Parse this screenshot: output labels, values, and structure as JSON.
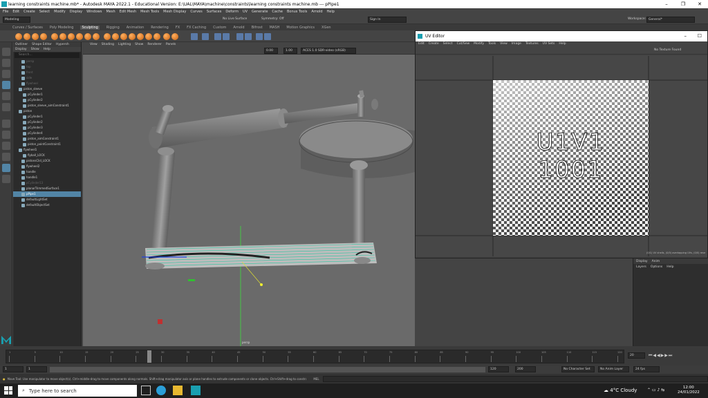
{
  "window": {
    "title": "learning constraints machine.mb* - Autodesk MAYA 2022.1 - Educational Version: E:\\UAL\\MAYA\\machine\\constraints\\learning constraints machine.mb  ---  pPipe1",
    "minimize": "–",
    "maximize": "❐",
    "close": "✕"
  },
  "menus": [
    "File",
    "Edit",
    "Create",
    "Select",
    "Modify",
    "Display",
    "Windows",
    "Mesh",
    "Edit Mesh",
    "Mesh Tools",
    "Mesh Display",
    "Curves",
    "Surfaces",
    "Deform",
    "UV",
    "Generate",
    "Cache",
    "Bonus Tools",
    "Arnold",
    "Help"
  ],
  "status": {
    "mode": "Modeling",
    "no_live_surface": "No Live Surface",
    "symmetry": "Symmetry: Off",
    "sign_in": "Sign In",
    "workspace_label": "Workspace:",
    "workspace_value": "General*"
  },
  "shelf_tabs": [
    "Curves / Surfaces",
    "Poly Modeling",
    "Sculpting",
    "Rigging",
    "Animation",
    "Rendering",
    "FX",
    "FX Caching",
    "Custom",
    "Arnold",
    "Bifrost",
    "MASH",
    "Motion Graphics",
    "XGen"
  ],
  "outliner": {
    "tabs": [
      "Outliner",
      "Shape Editor",
      "Hypersh"
    ],
    "menu": [
      "Display",
      "Show",
      "Help"
    ],
    "search_placeholder": "Search...",
    "items": [
      {
        "label": "persp",
        "dim": true
      },
      {
        "label": "top",
        "dim": true
      },
      {
        "label": "front",
        "dim": true
      },
      {
        "label": "side",
        "dim": true
      },
      {
        "label": "flywheel",
        "dim": true
      },
      {
        "label": "piston_sleeve"
      },
      {
        "label": "pCylinder1"
      },
      {
        "label": "pCylinder2"
      },
      {
        "label": "piston_sleeve_aimConstraint1"
      },
      {
        "label": "piston"
      },
      {
        "label": "pCylinder1"
      },
      {
        "label": "pCylinder2"
      },
      {
        "label": "pCylinder3"
      },
      {
        "label": "pCylinder4"
      },
      {
        "label": "piston_aimConstraint1"
      },
      {
        "label": "piston_pointConstraint1"
      },
      {
        "label": "flywheel1"
      },
      {
        "label": "flyball_LOCK"
      },
      {
        "label": "pistonsClid_LOCK"
      },
      {
        "label": "flywheel2"
      },
      {
        "label": "handle"
      },
      {
        "label": "handle1"
      },
      {
        "label": "pCylinder13",
        "dim": true
      },
      {
        "label": "planarTrimmedSurface1"
      },
      {
        "label": "pPipe1",
        "selected": true
      },
      {
        "label": "defaultLightSet"
      },
      {
        "label": "defaultObjectSet"
      }
    ]
  },
  "viewport": {
    "menu": [
      "View",
      "Shading",
      "Lighting",
      "Show",
      "Renderer",
      "Panels"
    ],
    "exposure": "0.00",
    "gamma": "1.00",
    "colorspace": "ACES 1.0 SDR-video (sRGB)",
    "camera": "persp"
  },
  "uv_editor": {
    "title": "UV Editor",
    "menu": [
      "Edit",
      "Create",
      "Select",
      "Cut/Sew",
      "Modify",
      "Tools",
      "View",
      "Image",
      "Textures",
      "UV Sets",
      "Help"
    ],
    "no_texture": "No Texture Found",
    "tile_label_1": "U1V1",
    "tile_label_2": "1001",
    "status": "(0/1) UV shells, (0/0) overlapping UVs, (0/0) reve"
  },
  "layers": {
    "tabs": [
      "Display",
      "Anim"
    ],
    "menu": [
      "Layers",
      "Options",
      "Help"
    ]
  },
  "timeline": {
    "ticks": [
      "1",
      "5",
      "10",
      "15",
      "20",
      "25",
      "30",
      "35",
      "40",
      "45",
      "50",
      "55",
      "60",
      "65",
      "70",
      "75",
      "80",
      "85",
      "90",
      "95",
      "100",
      "105",
      "110",
      "115",
      "120"
    ],
    "current_frame": "20",
    "start": "1",
    "start2": "1",
    "end": "120",
    "end2": "120",
    "range_end": "200",
    "character_set": "No Character Set",
    "anim_layer": "No Anim Layer",
    "fps": "24 fps"
  },
  "help": {
    "mel": "MEL",
    "text": "Move Tool: Use manipulator to move object(s). Ctrl+middle-drag to move components along normals. Shift+drag manipulator axis or plane handles to extrude components or clone objects. Ctrl+Shift+drag to constrain movement to a con"
  },
  "taskbar": {
    "search_placeholder": "Type here to search",
    "weather_temp": "4°C",
    "weather_text": "Cloudy",
    "time": "12:00",
    "date": "24/01/2022"
  }
}
